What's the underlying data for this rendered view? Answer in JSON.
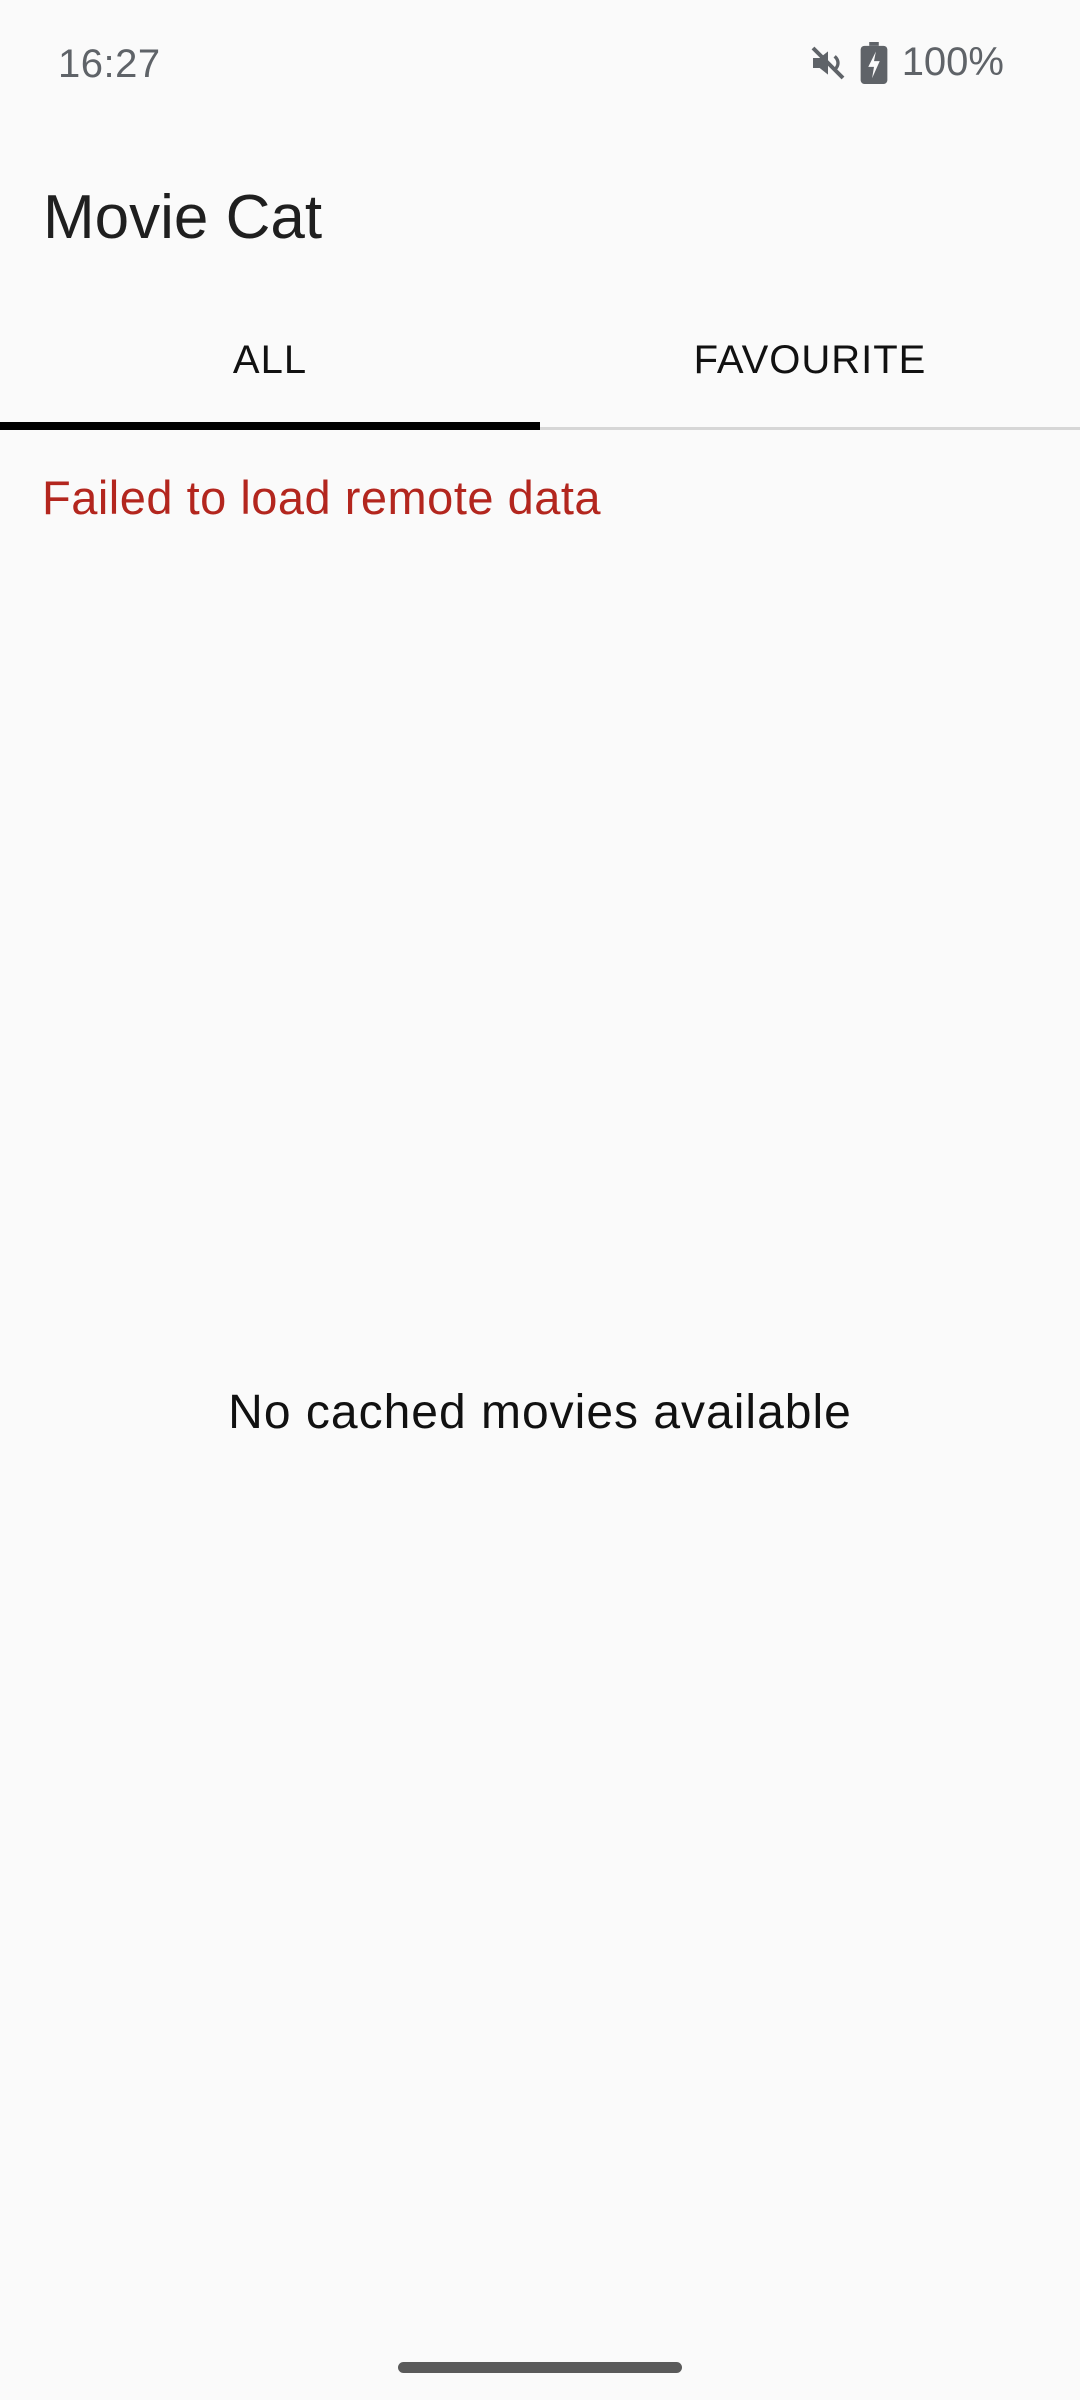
{
  "status_bar": {
    "time": "16:27",
    "icons": [
      "mute-icon",
      "battery-charging-icon"
    ],
    "battery_percent": "100%"
  },
  "app": {
    "title": "Movie Cat"
  },
  "tabs": [
    {
      "label": "ALL",
      "active": true
    },
    {
      "label": "FAVOURITE",
      "active": false
    }
  ],
  "content": {
    "error_message": "Failed to load remote data",
    "empty_message": "No cached movies available"
  },
  "colors": {
    "background": "#fafafa",
    "error": "#b3261e",
    "tab_indicator": "#000000"
  }
}
